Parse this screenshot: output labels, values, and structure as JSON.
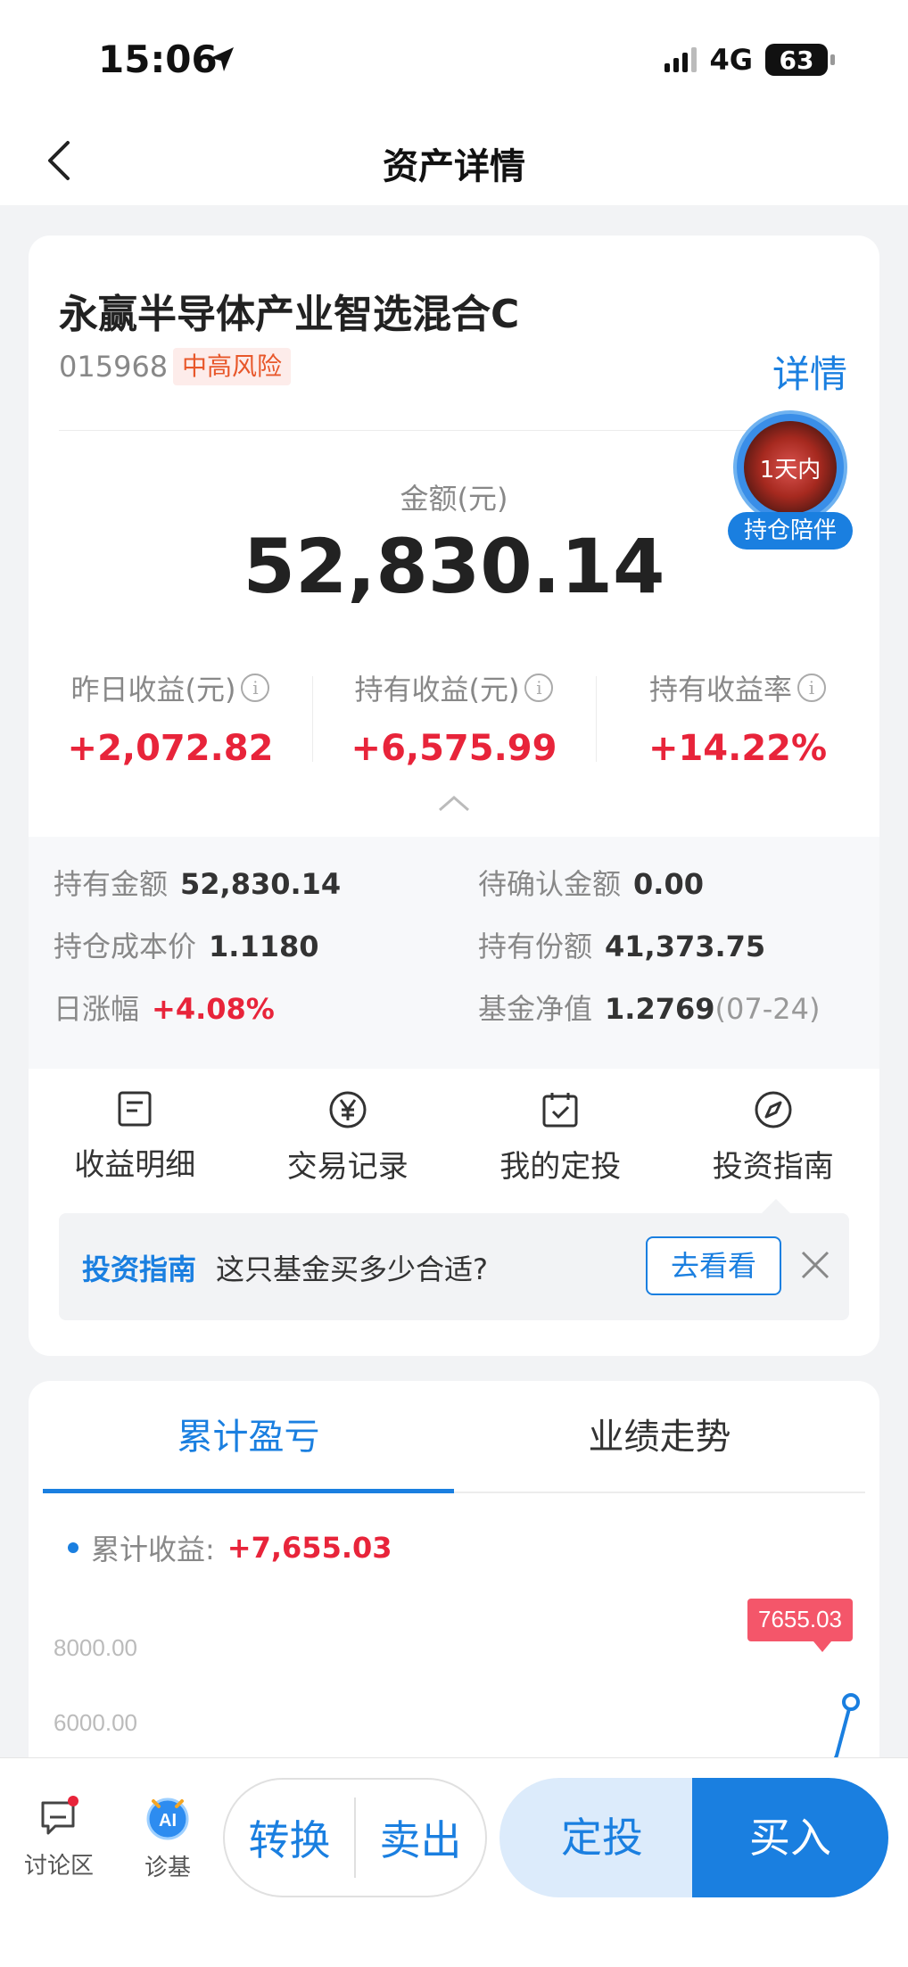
{
  "status": {
    "time": "15:06",
    "network": "4G",
    "battery": "63"
  },
  "nav": {
    "title": "资产详情"
  },
  "fund": {
    "name": "永赢半导体产业智选混合C",
    "code": "015968",
    "risk": "中高风险",
    "detail_link": "详情"
  },
  "companion": {
    "badge": "1天内",
    "label": "持仓陪伴"
  },
  "amount": {
    "label": "金额(元)",
    "value": "52,830.14"
  },
  "stats": [
    {
      "label": "昨日收益(元)",
      "value": "+2,072.82"
    },
    {
      "label": "持有收益(元)",
      "value": "+6,575.99"
    },
    {
      "label": "持有收益率",
      "value": "+14.22%"
    }
  ],
  "details": {
    "holding_amount_label": "持有金额",
    "holding_amount": "52,830.14",
    "pending_label": "待确认金额",
    "pending": "0.00",
    "cost_label": "持仓成本价",
    "cost": "1.1180",
    "shares_label": "持有份额",
    "shares": "41,373.75",
    "daily_change_label": "日涨幅",
    "daily_change": "+4.08%",
    "nav_label": "基金净值",
    "nav": "1.2769",
    "nav_date": "(07-24)"
  },
  "quick_actions": [
    {
      "label": "收益明细",
      "icon": "document-icon"
    },
    {
      "label": "交易记录",
      "icon": "yen-icon"
    },
    {
      "label": "我的定投",
      "icon": "calendar-icon"
    },
    {
      "label": "投资指南",
      "icon": "compass-icon"
    }
  ],
  "tip": {
    "brand": "投资指南",
    "text": "这只基金买多少合适?",
    "button": "去看看"
  },
  "tabs": [
    {
      "label": "累计盈亏"
    },
    {
      "label": "业绩走势"
    }
  ],
  "chart_legend": {
    "label": "累计收益:",
    "value": "+7,655.03"
  },
  "chart_data": {
    "type": "line",
    "series": [
      {
        "name": "累计收益",
        "values": [
          7655.03
        ]
      }
    ],
    "y_ticks": [
      "8000.00",
      "6000.00"
    ],
    "ylim": [
      0,
      8000
    ],
    "callout": "7655.03"
  },
  "bottom": {
    "discussion": "讨论区",
    "diagnose": "诊基",
    "convert": "转换",
    "sell": "卖出",
    "sip": "定投",
    "buy": "买入"
  },
  "colors": {
    "accent": "#1a7fe0",
    "gain": "#e8243a",
    "risk": "#e8572a"
  }
}
